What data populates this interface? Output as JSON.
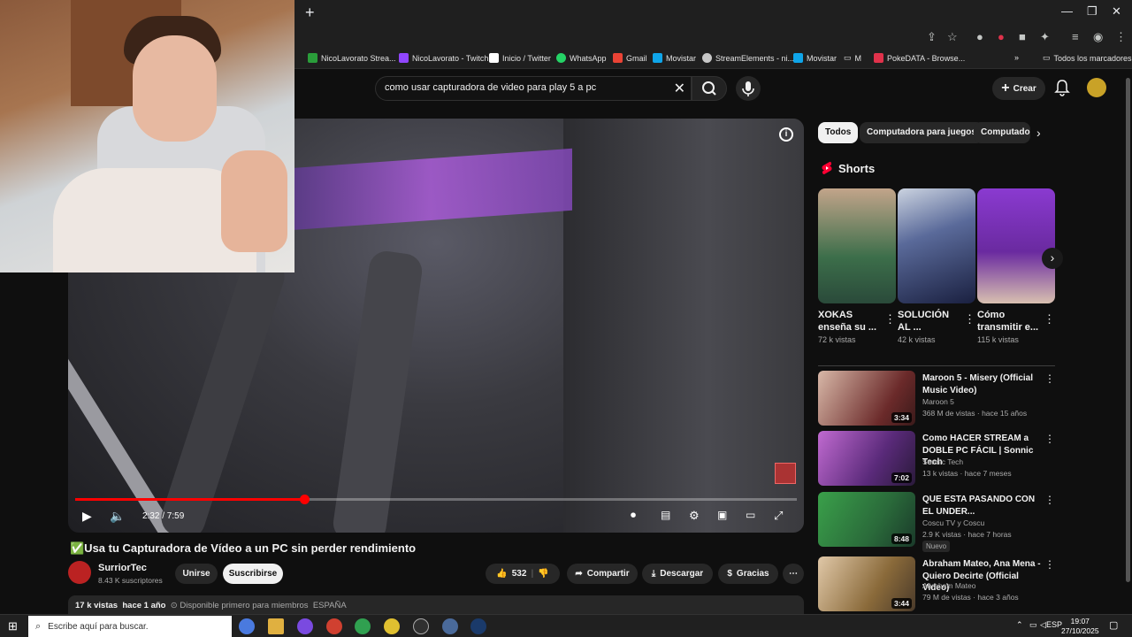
{
  "bookmarks": [
    {
      "label": "NicoLavorato Strea...",
      "color": "#2a9d3a"
    },
    {
      "label": "NicoLavorato - Twitch",
      "color": "#9146ff"
    },
    {
      "label": "Inicio / Twitter",
      "color": "#ffffff"
    },
    {
      "label": "WhatsApp",
      "color": "#25d366"
    },
    {
      "label": "Gmail",
      "color": "#ea4335"
    },
    {
      "label": "Movistar",
      "color": "#0fa5e9"
    },
    {
      "label": "StreamElements - ni...",
      "color": "#c7c7c7"
    },
    {
      "label": "Movistar",
      "color": "#0fa5e9"
    },
    {
      "label": "M",
      "color": "#888888"
    },
    {
      "label": "PokeDATA - Browse...",
      "color": "#e0324b"
    }
  ],
  "bookmarks_all": "Todos los marcadores",
  "search": {
    "query": "como usar capturadora de video para play 5 a pc"
  },
  "header": {
    "create_label": "Crear"
  },
  "player": {
    "time": "2:32 / 7:59",
    "progress": 0.317
  },
  "video": {
    "title": "✅Usa tu Capturadora de Vídeo a un PC sin perder rendimiento",
    "channel": "SurriorTec",
    "subscribers": "8.43 K suscriptores",
    "join_label": "Unirse",
    "subscribe_label": "Suscribirse",
    "likes": "532",
    "share_label": "Compartir",
    "download_label": "Descargar",
    "thanks_label": "Gracias",
    "views": "17 k vistas",
    "age": "hace 1 año",
    "members_note": "⊙ Disponible primero para miembros",
    "country": "ESPAÑA"
  },
  "chips": [
    "Todos",
    "Computadora para juegos",
    "Computado"
  ],
  "shorts": {
    "heading": "Shorts",
    "items": [
      {
        "title": "XOKAS enseña su ...",
        "views": "72 k vistas",
        "color": "#3c6e4a"
      },
      {
        "title": "SOLUCIÓN AL ...",
        "views": "42 k vistas",
        "color": "#2a3a6a"
      },
      {
        "title": "Cómo transmitir e...",
        "views": "115 k vistas",
        "color": "#7b34b8"
      }
    ]
  },
  "recommendations": [
    {
      "title": "Maroon 5 - Misery (Official Music Video)",
      "channel": "Maroon 5",
      "meta": "368 M de vistas · hace 15 años",
      "duration": "3:34",
      "color": "#6b2a2a"
    },
    {
      "title": "Como HACER STREAM a DOBLE PC FÁCIL | Sonnic Tech",
      "channel": "Sonnic Tech",
      "meta": "13 k vistas · hace 7 meses",
      "duration": "7:02",
      "color": "#5a2a7a"
    },
    {
      "title": "QUE ESTA PASANDO CON EL UNDER...",
      "channel": "Coscu TV y Coscu",
      "meta": "2.9 K vistas · hace 7 horas",
      "duration": "8:48",
      "badge": "Nuevo",
      "color": "#2a6a3a"
    },
    {
      "title": "Abraham Mateo, Ana Mena - Quiero Decirte (Official Video)",
      "channel": "Abraham Mateo",
      "meta": "79 M de vistas · hace 3 años",
      "duration": "3:44",
      "color": "#8a6a3a"
    }
  ],
  "taskbar": {
    "search_placeholder": "Escribe aquí para buscar.",
    "lang": "ESP",
    "time": "19:07",
    "date": "27/10/2025"
  }
}
